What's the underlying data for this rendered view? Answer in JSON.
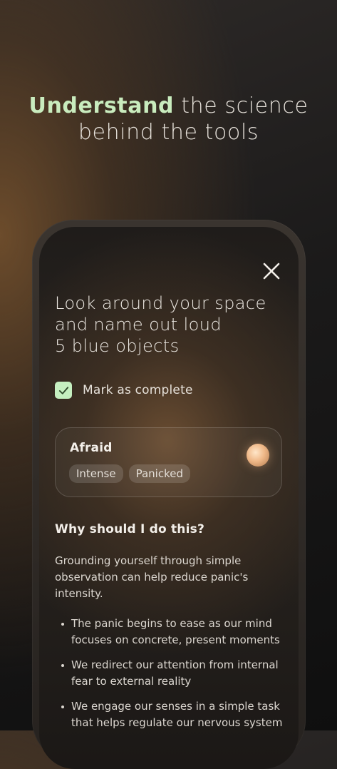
{
  "headline": {
    "accent": "Understand",
    "rest_line1": " the science",
    "line2": "behind the tools"
  },
  "tool": {
    "close_icon": "close-icon",
    "prompt_line1": "Look around your space",
    "prompt_line2": "and name out loud",
    "prompt_line3": "5 blue objects",
    "complete_checked": true,
    "complete_label": "Mark as complete"
  },
  "emotion": {
    "title": "Afraid",
    "tags": [
      "Intense",
      "Panicked"
    ]
  },
  "why": {
    "heading": "Why should I do this?",
    "body": "Grounding yourself through simple observation can help reduce panic's intensity.",
    "bullets": [
      "The panic begins to ease as our mind focuses on concrete, present moments",
      "We redirect our attention from internal fear to external reality",
      "We engage our senses in a simple task that helps regulate our nervous system"
    ]
  },
  "colors": {
    "accent_green": "#c9ecbe",
    "checkbox_green": "#c5efc0",
    "text_light": "#ece8e2"
  }
}
